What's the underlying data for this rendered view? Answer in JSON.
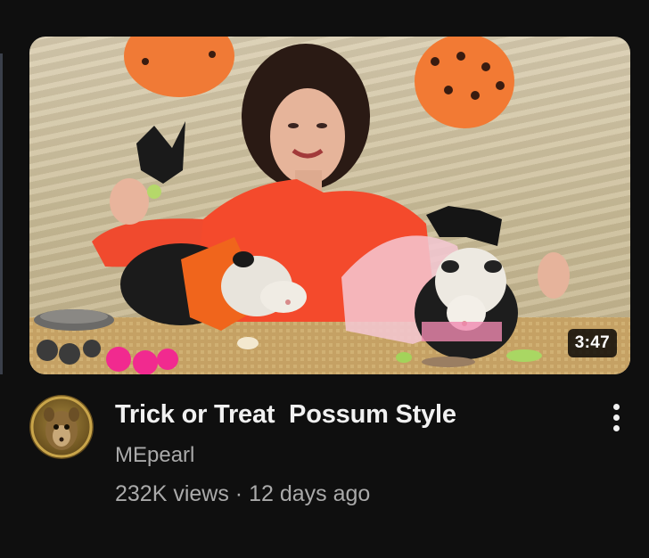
{
  "video": {
    "duration": "3:47",
    "title": "Trick or Treat  Possum Style",
    "channel": "MEpearl",
    "views": "232K views",
    "separator": " · ",
    "age": "12 days ago"
  },
  "icons": {
    "menu": "more-vertical-icon",
    "avatar": "channel-avatar-possum"
  },
  "colors": {
    "background": "#0f0f0f",
    "title": "#f1f1f1",
    "secondary_text": "#aaaaaa",
    "duration_badge": "#000000"
  }
}
